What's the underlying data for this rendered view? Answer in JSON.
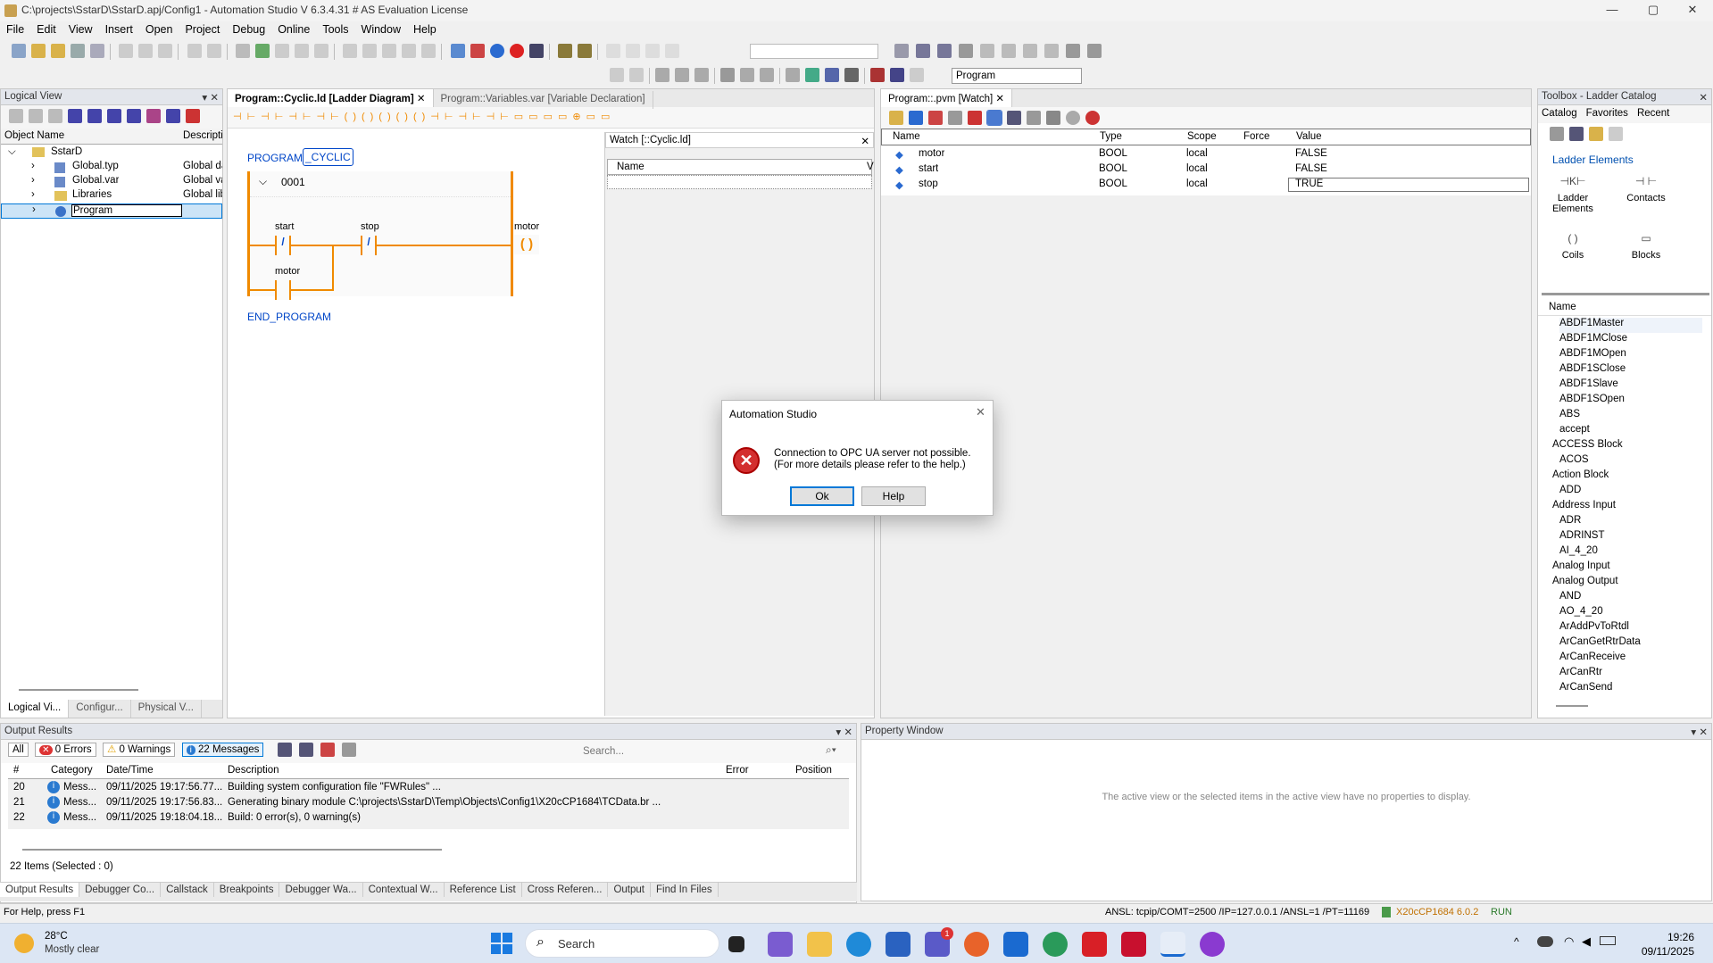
{
  "window": {
    "title": "C:\\projects\\SstarD\\SstarD.apj/Config1 - Automation Studio V 6.3.4.31 # AS Evaluation License"
  },
  "menu": [
    "File",
    "Edit",
    "View",
    "Insert",
    "Open",
    "Project",
    "Debug",
    "Online",
    "Tools",
    "Window",
    "Help"
  ],
  "toolbar": {
    "program_combo": "Program"
  },
  "logical_view": {
    "title": "Logical View",
    "columns": [
      "Object Name",
      "Descripti"
    ],
    "root": "SstarD",
    "items": [
      {
        "name": "Global.typ",
        "desc": "Global da"
      },
      {
        "name": "Global.var",
        "desc": "Global va"
      },
      {
        "name": "Libraries",
        "desc": "Global lib"
      },
      {
        "name": "Program",
        "desc": ""
      }
    ],
    "tabs": [
      "Logical Vi...",
      "Configur...",
      "Physical V..."
    ]
  },
  "editor": {
    "tabs": [
      "Program::Cyclic.ld [Ladder Diagram]",
      "Program::Variables.var [Variable Declaration]"
    ],
    "program_kw": "PROGRAM",
    "program_name": "_CYCLIC",
    "network": "0001",
    "contacts": [
      "start",
      "stop"
    ],
    "coil": "motor",
    "latch": "motor",
    "contact_symbol": "/",
    "coil_symbol": "( )",
    "end": "END_PROGRAM"
  },
  "watch_small": {
    "title": "Watch [::Cyclic.ld]",
    "col_name": "Name",
    "col_v": "V"
  },
  "watch": {
    "tab": "Program::.pvm [Watch]",
    "columns": [
      "Name",
      "Type",
      "Scope",
      "Force",
      "Value"
    ],
    "rows": [
      {
        "name": "motor",
        "type": "BOOL",
        "scope": "local",
        "force": "",
        "value": "FALSE"
      },
      {
        "name": "start",
        "type": "BOOL",
        "scope": "local",
        "force": "",
        "value": "FALSE"
      },
      {
        "name": "stop",
        "type": "BOOL",
        "scope": "local",
        "force": "",
        "value": "TRUE"
      }
    ]
  },
  "toolbox": {
    "title": "Toolbox - Ladder Catalog",
    "tabs": [
      "Catalog",
      "Favorites",
      "Recent"
    ],
    "section": "Ladder Elements",
    "tiles": [
      {
        "label": "Ladder\nElements",
        "glyph": "⊣K⊢"
      },
      {
        "label": "Contacts",
        "glyph": "⊣ ⊢"
      },
      {
        "label": "Coils",
        "glyph": "( )"
      },
      {
        "label": "Blocks",
        "glyph": "▭"
      }
    ],
    "list_header": "Name",
    "items": [
      "ABDF1Master",
      "ABDF1MClose",
      "ABDF1MOpen",
      "ABDF1SClose",
      "ABDF1Slave",
      "ABDF1SOpen",
      "ABS",
      "accept",
      "ACCESS Block",
      "ACOS",
      "Action Block",
      "ADD",
      "Address Input",
      "ADR",
      "ADRINST",
      "AI_4_20",
      "Analog Input",
      "Analog Output",
      "AND",
      "AO_4_20",
      "ArAddPvToRtdl",
      "ArCanGetRtrData",
      "ArCanReceive",
      "ArCanRtr",
      "ArCanSend"
    ]
  },
  "output": {
    "title": "Output Results",
    "filters": {
      "all": "All",
      "errors": "0 Errors",
      "warnings": "0 Warnings",
      "messages": "22 Messages"
    },
    "search_placeholder": "Search...",
    "columns": [
      "#",
      "Category",
      "Date/Time",
      "Description",
      "Error",
      "Position"
    ],
    "rows": [
      {
        "n": "20",
        "cat": "Mess...",
        "dt": "09/11/2025 19:17:56.77...",
        "desc": "Building system configuration file \"FWRules\" ..."
      },
      {
        "n": "21",
        "cat": "Mess...",
        "dt": "09/11/2025 19:17:56.83...",
        "desc": "Generating binary module C:\\projects\\SstarD\\Temp\\Objects\\Config1\\X20cCP1684\\TCData.br ..."
      },
      {
        "n": "22",
        "cat": "Mess...",
        "dt": "09/11/2025 19:18:04.18...",
        "desc": "Build: 0 error(s), 0 warning(s)"
      }
    ],
    "footer": "22 Items (Selected : 0)",
    "bottom_tabs": [
      "Output Results",
      "Debugger Co...",
      "Callstack",
      "Breakpoints",
      "Debugger Wa...",
      "Contextual W...",
      "Reference List",
      "Cross Referen...",
      "Output",
      "Find In Files"
    ]
  },
  "property": {
    "title": "Property Window",
    "empty": "The active view or the selected items in the active view have no properties to display."
  },
  "statusbar": {
    "help": "For Help, press F1",
    "conn": "ANSL: tcpip/COMT=2500 /IP=127.0.0.1 /ANSL=1 /PT=11169",
    "target": "X20cCP1684  6.0.2",
    "state": "RUN"
  },
  "dialog": {
    "title": "Automation Studio",
    "line1": "Connection to OPC UA server not possible.",
    "line2": "(For more details please refer to the help.)",
    "ok": "Ok",
    "help": "Help"
  },
  "taskbar": {
    "temp": "28°C",
    "weather": "Mostly clear",
    "search": "Search",
    "time": "19:26",
    "date": "09/11/2025",
    "badge": "1"
  }
}
